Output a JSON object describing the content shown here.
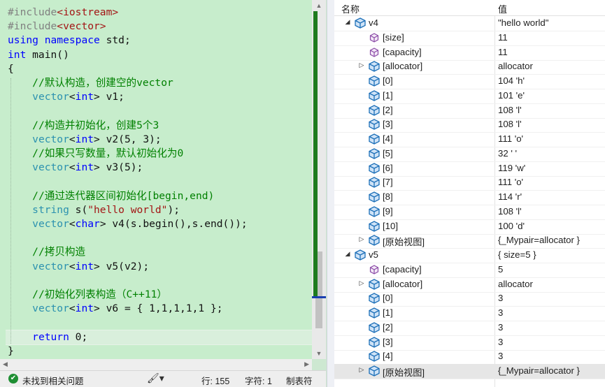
{
  "editor": {
    "lines": [
      [
        [
          "#include",
          "pp"
        ],
        [
          "<iostream>",
          "st"
        ]
      ],
      [
        [
          "#include",
          "pp"
        ],
        [
          "<vector>",
          "st"
        ]
      ],
      [
        [
          "using",
          "kw"
        ],
        [
          " ",
          ""
        ],
        [
          "namespace",
          "kw"
        ],
        [
          " std;",
          ""
        ]
      ],
      [
        [
          "int",
          "kw"
        ],
        [
          " main()",
          ""
        ]
      ],
      [
        [
          "{",
          ""
        ]
      ],
      [
        [
          "    ",
          ""
        ],
        [
          "//默认构造，创建空的vector",
          "cm"
        ]
      ],
      [
        [
          "    ",
          ""
        ],
        [
          "vector",
          "ty"
        ],
        [
          "<",
          ""
        ],
        [
          "int",
          "kw"
        ],
        [
          "> v1;",
          ""
        ]
      ],
      [
        [
          "",
          ""
        ]
      ],
      [
        [
          "    ",
          ""
        ],
        [
          "//构造并初始化，创建5个3",
          "cm"
        ]
      ],
      [
        [
          "    ",
          ""
        ],
        [
          "vector",
          "ty"
        ],
        [
          "<",
          ""
        ],
        [
          "int",
          "kw"
        ],
        [
          "> v2(5, 3);",
          ""
        ]
      ],
      [
        [
          "    ",
          ""
        ],
        [
          "//如果只写数量，默认初始化为0",
          "cm"
        ]
      ],
      [
        [
          "    ",
          ""
        ],
        [
          "vector",
          "ty"
        ],
        [
          "<",
          ""
        ],
        [
          "int",
          "kw"
        ],
        [
          "> v3(5);",
          ""
        ]
      ],
      [
        [
          "",
          ""
        ]
      ],
      [
        [
          "    ",
          ""
        ],
        [
          "//通过迭代器区间初始化[begin,end)",
          "cm"
        ]
      ],
      [
        [
          "    ",
          ""
        ],
        [
          "string",
          "ty"
        ],
        [
          " s(",
          ""
        ],
        [
          "\"hello world\"",
          "st"
        ],
        [
          ");",
          ""
        ]
      ],
      [
        [
          "    ",
          ""
        ],
        [
          "vector",
          "ty"
        ],
        [
          "<",
          ""
        ],
        [
          "char",
          "kw"
        ],
        [
          "> v4(s.begin(),s.end());",
          ""
        ]
      ],
      [
        [
          "",
          ""
        ]
      ],
      [
        [
          "    ",
          ""
        ],
        [
          "//拷贝构造",
          "cm"
        ]
      ],
      [
        [
          "    ",
          ""
        ],
        [
          "vector",
          "ty"
        ],
        [
          "<",
          ""
        ],
        [
          "int",
          "kw"
        ],
        [
          "> v5(v2);",
          ""
        ]
      ],
      [
        [
          "",
          ""
        ]
      ],
      [
        [
          "    ",
          ""
        ],
        [
          "//初始化列表构造（C++11）",
          "cm"
        ]
      ],
      [
        [
          "    ",
          ""
        ],
        [
          "vector",
          "ty"
        ],
        [
          "<",
          ""
        ],
        [
          "int",
          "kw"
        ],
        [
          "> v6 = { 1,1,1,1,1 };",
          ""
        ]
      ],
      [
        [
          "",
          ""
        ]
      ],
      [
        [
          "    ",
          ""
        ],
        [
          "return",
          "kw"
        ],
        [
          " 0;",
          ""
        ]
      ],
      [
        [
          "}",
          ""
        ]
      ]
    ]
  },
  "status": {
    "issues": "未找到相关问题",
    "line": "行: 155",
    "col": "字符: 1",
    "tab": "制表符"
  },
  "watch": {
    "header_name": "名称",
    "header_value": "值",
    "rows": [
      {
        "name": "v4",
        "value": "\"hello world\"",
        "level": 0,
        "expander": "open",
        "icon": "object-icon"
      },
      {
        "name": "[size]",
        "value": "11",
        "level": 1,
        "expander": "none",
        "icon": "property-icon"
      },
      {
        "name": "[capacity]",
        "value": "11",
        "level": 1,
        "expander": "none",
        "icon": "property-icon"
      },
      {
        "name": "[allocator]",
        "value": "allocator",
        "level": 1,
        "expander": "closed",
        "icon": "object-icon"
      },
      {
        "name": "[0]",
        "value": "104 'h'",
        "level": 1,
        "expander": "none",
        "icon": "object-icon"
      },
      {
        "name": "[1]",
        "value": "101 'e'",
        "level": 1,
        "expander": "none",
        "icon": "object-icon"
      },
      {
        "name": "[2]",
        "value": "108 'l'",
        "level": 1,
        "expander": "none",
        "icon": "object-icon"
      },
      {
        "name": "[3]",
        "value": "108 'l'",
        "level": 1,
        "expander": "none",
        "icon": "object-icon"
      },
      {
        "name": "[4]",
        "value": "111 'o'",
        "level": 1,
        "expander": "none",
        "icon": "object-icon"
      },
      {
        "name": "[5]",
        "value": "32 ' '",
        "level": 1,
        "expander": "none",
        "icon": "object-icon"
      },
      {
        "name": "[6]",
        "value": "119 'w'",
        "level": 1,
        "expander": "none",
        "icon": "object-icon"
      },
      {
        "name": "[7]",
        "value": "111 'o'",
        "level": 1,
        "expander": "none",
        "icon": "object-icon"
      },
      {
        "name": "[8]",
        "value": "114 'r'",
        "level": 1,
        "expander": "none",
        "icon": "object-icon"
      },
      {
        "name": "[9]",
        "value": "108 'l'",
        "level": 1,
        "expander": "none",
        "icon": "object-icon"
      },
      {
        "name": "[10]",
        "value": "100 'd'",
        "level": 1,
        "expander": "none",
        "icon": "object-icon"
      },
      {
        "name": "[原始视图]",
        "value": "{_Mypair=allocator }",
        "level": 1,
        "expander": "closed",
        "icon": "object-icon"
      },
      {
        "name": "v5",
        "value": "{ size=5 }",
        "level": 0,
        "expander": "open",
        "icon": "object-icon"
      },
      {
        "name": "[capacity]",
        "value": "5",
        "level": 1,
        "expander": "none",
        "icon": "property-icon"
      },
      {
        "name": "[allocator]",
        "value": "allocator",
        "level": 1,
        "expander": "closed",
        "icon": "object-icon"
      },
      {
        "name": "[0]",
        "value": "3",
        "level": 1,
        "expander": "none",
        "icon": "object-icon"
      },
      {
        "name": "[1]",
        "value": "3",
        "level": 1,
        "expander": "none",
        "icon": "object-icon"
      },
      {
        "name": "[2]",
        "value": "3",
        "level": 1,
        "expander": "none",
        "icon": "object-icon"
      },
      {
        "name": "[3]",
        "value": "3",
        "level": 1,
        "expander": "none",
        "icon": "object-icon"
      },
      {
        "name": "[4]",
        "value": "3",
        "level": 1,
        "expander": "none",
        "icon": "object-icon"
      },
      {
        "name": "[原始视图]",
        "value": "{_Mypair=allocator }",
        "level": 1,
        "expander": "closed",
        "icon": "object-icon",
        "selected": true
      }
    ]
  }
}
